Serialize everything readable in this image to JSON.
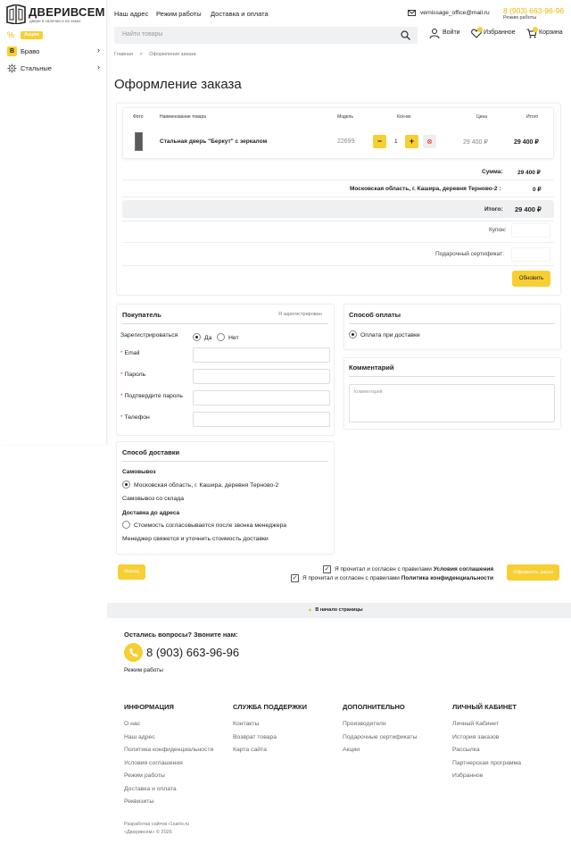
{
  "brand": {
    "name": "ДВЕРИВСЕМ",
    "tagline": "двери в наличии и на заказ"
  },
  "sidebar": {
    "promo_label": "Акция",
    "items": [
      {
        "label": "Браво",
        "icon": "bravo-logo-icon"
      },
      {
        "label": "Стальные",
        "icon": "gear-icon"
      }
    ]
  },
  "header": {
    "nav": [
      "Наш адрес",
      "Режим работы",
      "Доставка и оплата"
    ],
    "email": "vernissage_office@mail.ru",
    "phone": "8 (903) 663-96-96",
    "hours_link": "Режим работы",
    "search_placeholder": "Найти товары",
    "login": "Войти",
    "favorites": "Избранное",
    "cart": "Корзина"
  },
  "breadcrumb": {
    "home": "Главная",
    "sep": ">",
    "current": "Оформление заказа"
  },
  "page_title": "Оформление заказа",
  "cart": {
    "columns": {
      "photo": "Фото",
      "name": "Наименование товара",
      "model": "Модель",
      "qty": "Кол-во",
      "price": "Цена",
      "total": "Итого"
    },
    "items": [
      {
        "name": "Стальная дверь \"Беркут\" с зеркалом",
        "model": "22699",
        "qty": "1",
        "price": "29 400 ₽",
        "total": "29 400 ₽"
      }
    ],
    "summary": {
      "sum_label": "Сумма:",
      "sum_value": "29 400 ₽",
      "delivery_label": "Московская область, г. Кашира, деревня Терново-2 :",
      "delivery_value": "0 ₽",
      "total_label": "Итого:",
      "total_value": "29 400 ₽"
    },
    "coupon_label": "Купон:",
    "certificate_label": "Подарочный сертификат:",
    "update_button": "Обновить",
    "minus": "−",
    "plus": "+",
    "remove": "⊗"
  },
  "buyer": {
    "title": "Покупатель",
    "registered_link": "Я зарегистрирован",
    "register_label": "Зарегистрироваться",
    "yes": "Да",
    "no": "Нет",
    "fields": {
      "email": "Email",
      "password": "Пароль",
      "confirm": "Подтвердите пароль",
      "phone": "Телефон"
    },
    "required_mark": "*"
  },
  "payment": {
    "title": "Способ оплаты",
    "option": "Оплата при доставке"
  },
  "comment": {
    "title": "Комментарий",
    "placeholder": "Комментарий"
  },
  "delivery": {
    "title": "Способ доставки",
    "pickup_title": "Самовывоз",
    "pickup_option": "Московская область, г. Кашира, деревня Терново-2",
    "pickup_note": "Самовывоз со склада",
    "address_title": "Доставка до адреса",
    "address_option": "Стоимость согласовывается после звонка менеджера",
    "address_note": "Менеджер свяжется и уточнить стоимость доставки"
  },
  "actions": {
    "back": "Назад",
    "agree_prefix": "Я прочитал и согласен с правилами",
    "agree_terms": "Условия соглашения",
    "agree_privacy": "Политика конфиденциальности",
    "submit": "Оформить заказ"
  },
  "to_top": "В начало страницы",
  "footer": {
    "question": "Остались вопросы? Звоните нам:",
    "phone": "8 (903) 663-96-96",
    "hours": "Режим работы",
    "columns": [
      {
        "title": "ИНФОРМАЦИЯ",
        "items": [
          "О нас",
          "Наш адрес",
          "Политика конфиденциальности",
          "Условия соглашения",
          "Режим работы",
          "Доставка и оплата",
          "Реквизиты"
        ]
      },
      {
        "title": "СЛУЖБА ПОДДЕРЖКИ",
        "items": [
          "Контакты",
          "Возврат товара",
          "Карта сайта"
        ]
      },
      {
        "title": "ДОПОЛНИТЕЛЬНО",
        "items": [
          "Производители",
          "Подарочные сертификаты",
          "Акции"
        ]
      },
      {
        "title": "ЛИЧНЫЙ КАБИНЕТ",
        "items": [
          "Личный Кабинет",
          "История заказов",
          "Рассылка",
          "Партнерская программа",
          "Избранное"
        ]
      }
    ],
    "dev": "Разработка сайтов r1sarto.ru",
    "copyright": "«Двeривсем» © 2026"
  },
  "colors": {
    "accent": "#f7cf33",
    "phone": "#f0b400"
  }
}
